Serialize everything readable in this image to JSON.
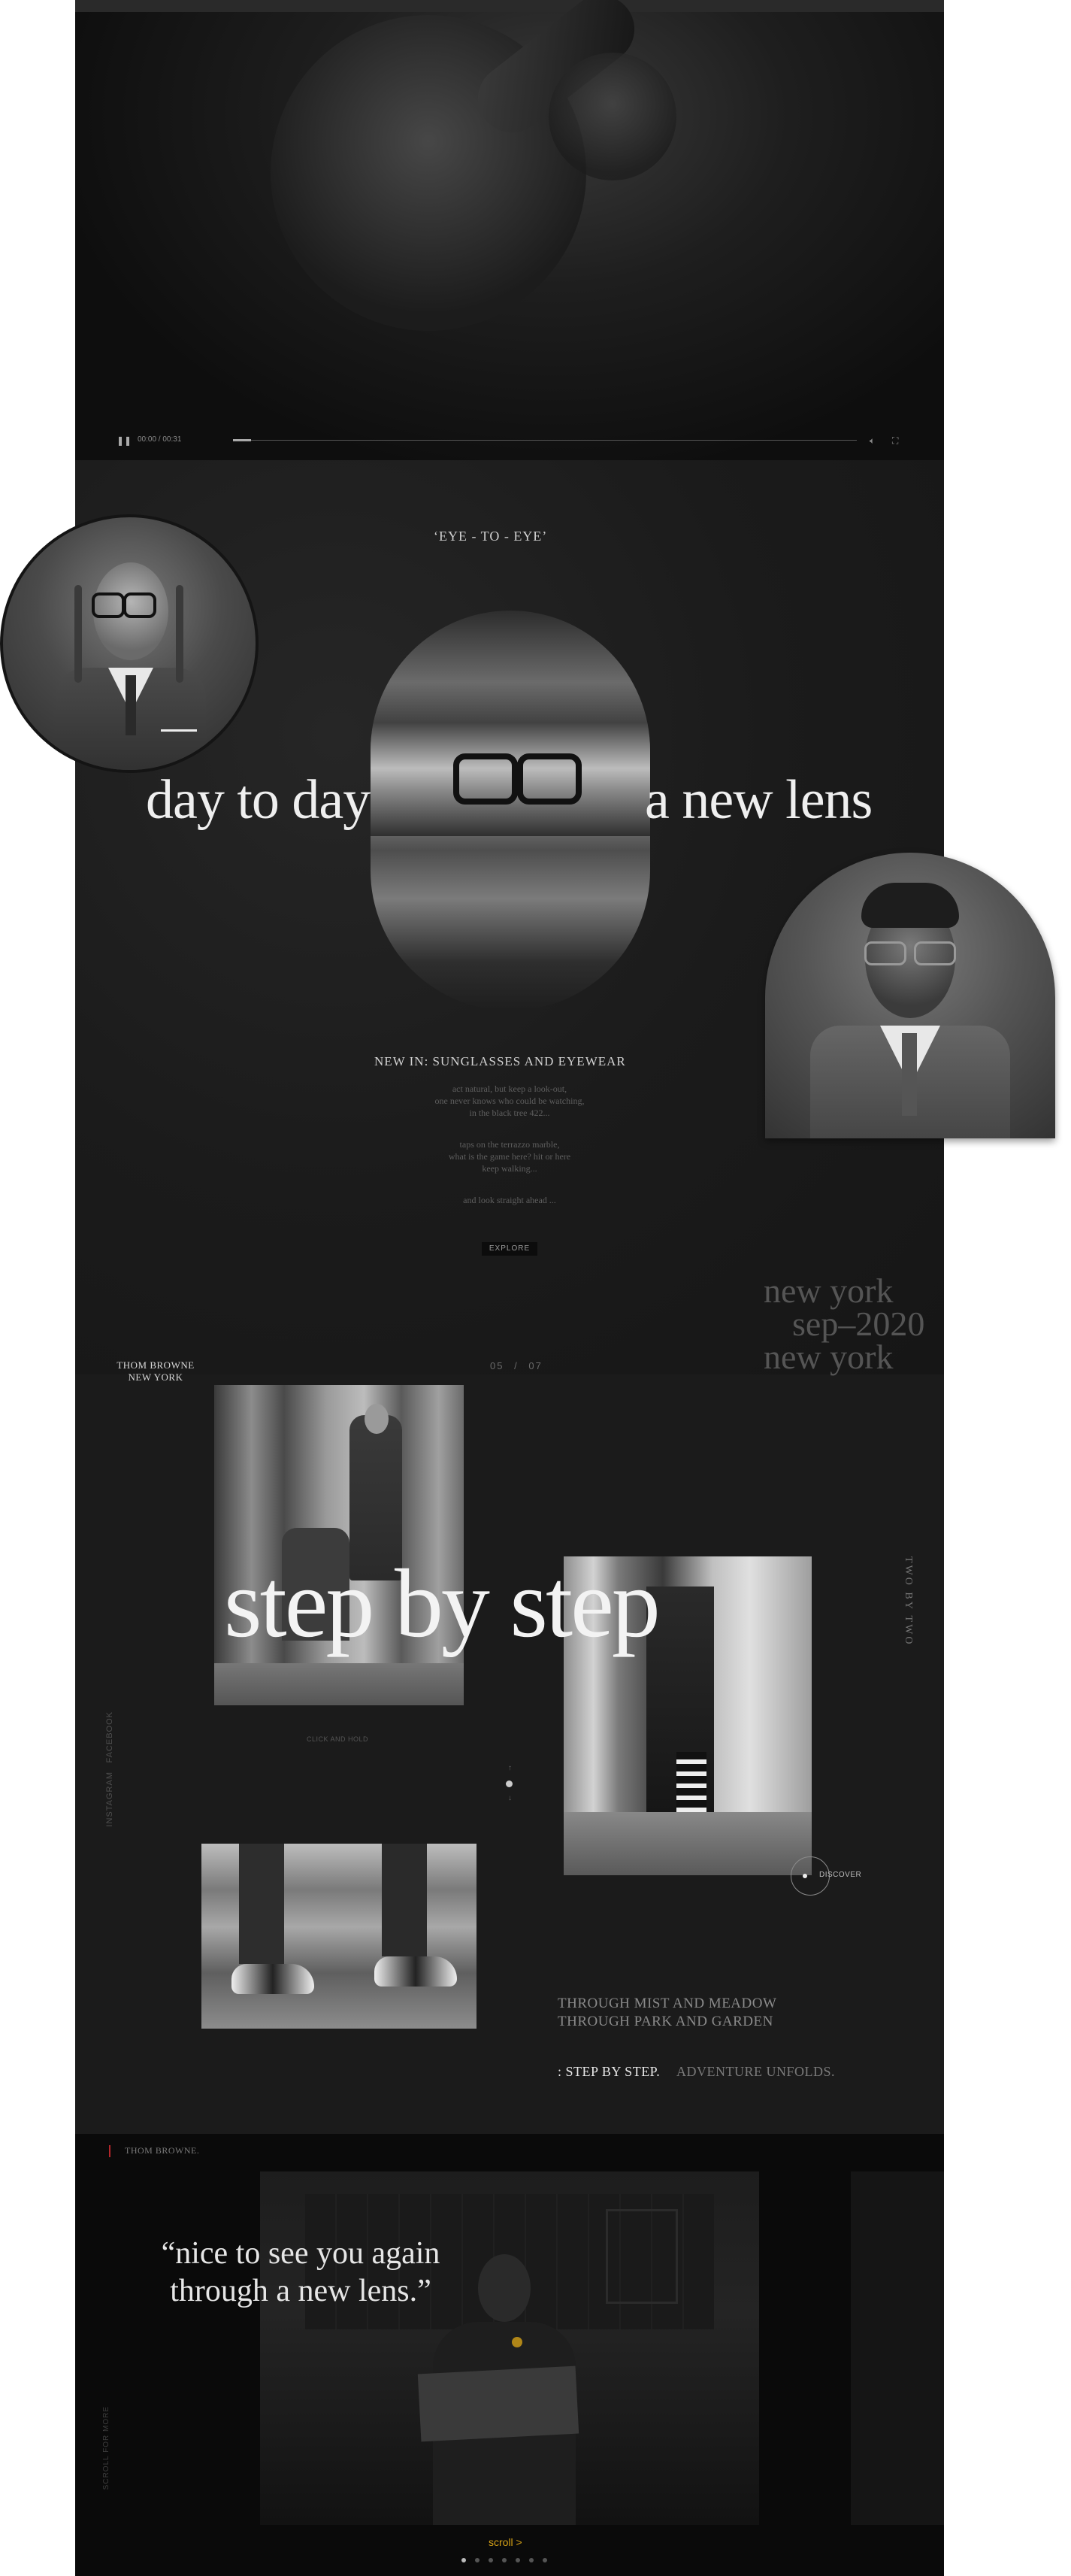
{
  "video": {
    "time": "00:00 / 00:31"
  },
  "intro": {
    "kicker": "‘EYE - TO - EYE’",
    "headline_left": "day to day",
    "headline_right": "a new lens",
    "section_title": "NEW IN: SUNGLASSES AND EYEWEAR",
    "poem_1": [
      "act natural, but keep a look-out,",
      "one never knows who could be watching,",
      "in the black tree 422..."
    ],
    "poem_2": [
      "taps on the terrazzo marble,",
      "what is the game here? hit or here",
      "keep walking..."
    ],
    "poem_3": "and look straight ahead ...",
    "button_label": "EXPLORE"
  },
  "location": {
    "line1": "new york",
    "line2": "sep–2020",
    "line3": "new york"
  },
  "gallery": {
    "brand_line1": "THOM BROWNE",
    "brand_line2": "NEW YORK",
    "counter_current": "05",
    "counter_sep": "/",
    "counter_total": "07",
    "headline": "step by step",
    "click_hint": "CLICK AND HOLD",
    "vertical_right": "TWO BY TWO",
    "social": [
      "INSTAGRAM",
      "FACEBOOK"
    ],
    "discover_label": "DISCOVER",
    "verse_1": "THROUGH MIST AND MEADOW",
    "verse_2": "THROUGH PARK AND GARDEN",
    "tagline_strong": ": STEP BY STEP.",
    "tagline_muted": "ADVENTURE UNFOLDS."
  },
  "footer": {
    "brand": "THOM BROWNE.",
    "quote_line1": "“nice to see you again",
    "quote_line2": "through a new lens.”",
    "scroll_label": "scroll >",
    "accent": "#d4a017",
    "vertical_left": "SCROLL FOR MORE",
    "active_dot": 1,
    "dot_count": 7
  }
}
